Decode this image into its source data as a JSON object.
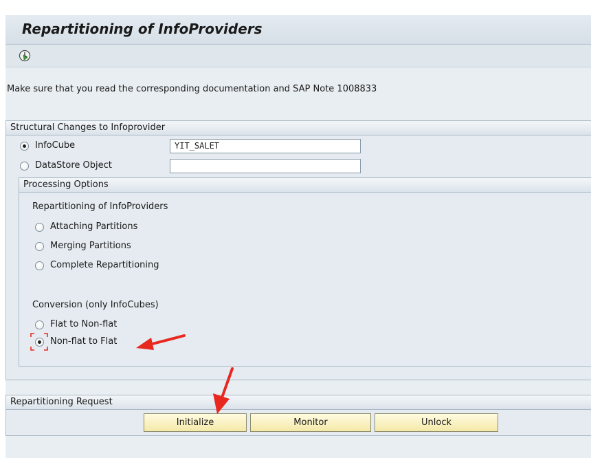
{
  "window": {
    "title": "Repartitioning of InfoProviders"
  },
  "toolbar": {
    "execute_icon": "execute-clock-icon"
  },
  "note": "Make sure that you read the corresponding documentation and SAP Note 1008833",
  "structural": {
    "header": "Structural Changes to Infoprovider",
    "infocube_label": "InfoCube",
    "infocube_value": "YIT_SALET",
    "datastore_label": "DataStore Object",
    "datastore_value": "",
    "selected": "InfoCube"
  },
  "processing": {
    "header": "Processing Options",
    "repartitioning_label": "Repartitioning of InfoProviders",
    "options": [
      "Attaching Partitions",
      "Merging Partitions",
      "Complete Repartitioning"
    ],
    "conversion_label": "Conversion (only InfoCubes)",
    "conversion_options": [
      "Flat to Non-flat",
      "Non-flat to Flat"
    ],
    "selected": "Non-flat to Flat"
  },
  "request": {
    "header": "Repartitioning Request",
    "buttons": [
      "Initialize",
      "Monitor",
      "Unlock"
    ]
  },
  "colors": {
    "annotation_arrow": "#e8281f",
    "button_fill": "#f7eeb6"
  }
}
